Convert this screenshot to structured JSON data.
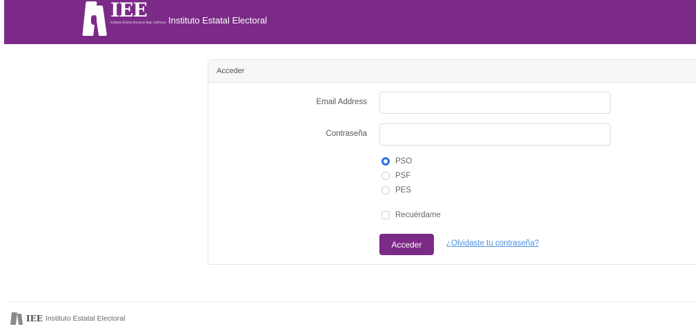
{
  "header": {
    "logo_text": "IEE",
    "logo_subtext": "Instituto Estatal Electoral Baja California",
    "brand_name": "Instituto Estatal Electoral",
    "background_color": "#7b2a87"
  },
  "login": {
    "card_title": "Acceder",
    "email": {
      "label": "Email Address",
      "value": "",
      "placeholder": ""
    },
    "password": {
      "label": "Contraseña",
      "value": "",
      "placeholder": ""
    },
    "roles": [
      {
        "label": "PSO",
        "checked": true
      },
      {
        "label": "PSF",
        "checked": false
      },
      {
        "label": "PES",
        "checked": false
      }
    ],
    "remember": {
      "label": "Recuérdame",
      "checked": false
    },
    "submit_label": "Acceder",
    "forgot_label": "¿Olvidaste tu contraseña?",
    "accent_color": "#7b2a87",
    "link_color": "#4a90e2"
  },
  "footer": {
    "logo_text": "IEE",
    "name": "Instituto Estatal Electoral"
  }
}
